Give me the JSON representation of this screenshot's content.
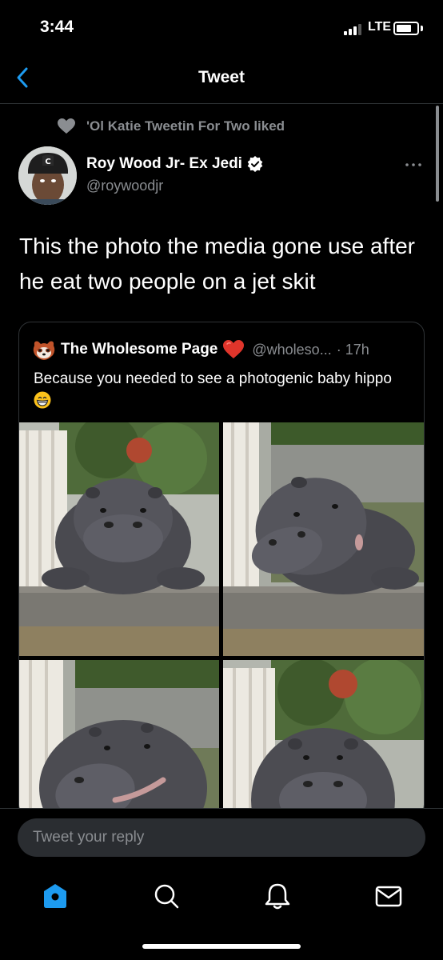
{
  "status_bar": {
    "time": "3:44",
    "network": "LTE"
  },
  "nav": {
    "title": "Tweet",
    "back_icon": "chevron-left-icon"
  },
  "tweet": {
    "social_context": "'Ol Katie Tweetin For Two liked",
    "author": {
      "name": "Roy Wood Jr- Ex Jedi",
      "handle": "@roywoodjr",
      "verified": true
    },
    "text": "This the photo the media gone use after he eat two people on a jet skit",
    "quoted": {
      "name": "The Wholesome Page",
      "handle": "@wholeso...",
      "time": "· 17h",
      "text": "Because you needed to see a photogenic baby hippo",
      "photo_count": 4
    }
  },
  "reply": {
    "placeholder": "Tweet your reply"
  },
  "tabs": [
    {
      "name": "home",
      "icon": "home-icon",
      "active": true
    },
    {
      "name": "search",
      "icon": "search-icon",
      "active": false
    },
    {
      "name": "notifications",
      "icon": "bell-icon",
      "active": false
    },
    {
      "name": "messages",
      "icon": "mail-icon",
      "active": false
    }
  ],
  "colors": {
    "background": "#000000",
    "accent": "#1d9bf0",
    "secondary_text": "#8a8d91",
    "border": "#2f3336"
  }
}
